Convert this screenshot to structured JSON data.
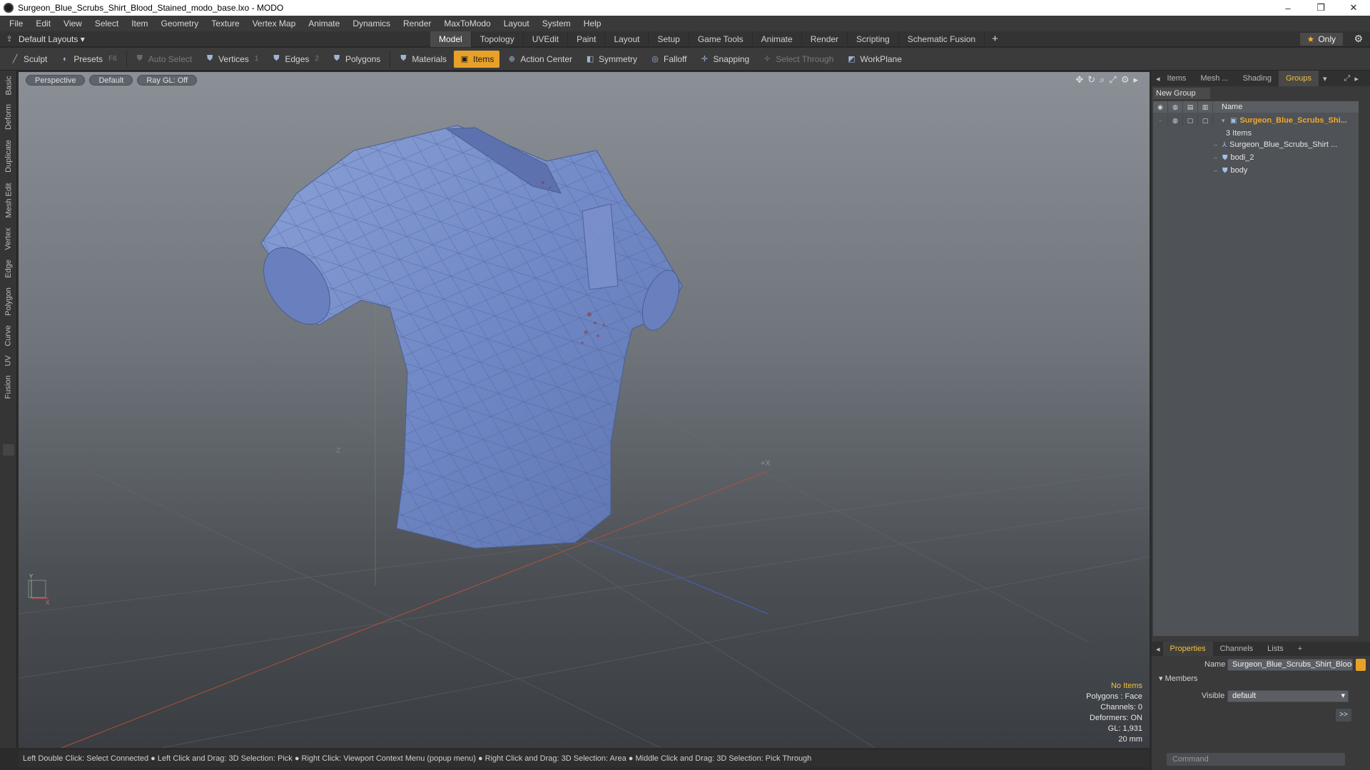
{
  "window": {
    "title": "Surgeon_Blue_Scrubs_Shirt_Blood_Stained_modo_base.lxo - MODO",
    "controls": [
      "–",
      "❐",
      "✕"
    ]
  },
  "menu": [
    "File",
    "Edit",
    "View",
    "Select",
    "Item",
    "Geometry",
    "Texture",
    "Vertex Map",
    "Animate",
    "Dynamics",
    "Render",
    "MaxToModo",
    "Layout",
    "System",
    "Help"
  ],
  "layoutbar": {
    "layout_select": "Default Layouts ▾",
    "tabs": [
      "Model",
      "Topology",
      "UVEdit",
      "Paint",
      "Layout",
      "Setup",
      "Game Tools",
      "Animate",
      "Render",
      "Scripting",
      "Schematic Fusion"
    ],
    "active_tab": "Model",
    "plus": "+",
    "only_label": "Only"
  },
  "toolbar": {
    "sculpt": "Sculpt",
    "presets": "Presets",
    "presets_key": "F6",
    "auto_select": "Auto Select",
    "vertices": "Vertices",
    "vertices_key": "1",
    "edges": "Edges",
    "edges_key": "2",
    "polygons": "Polygons",
    "materials": "Materials",
    "items": "Items",
    "action_center": "Action Center",
    "symmetry": "Symmetry",
    "falloff": "Falloff",
    "snapping": "Snapping",
    "select_through": "Select Through",
    "workplane": "WorkPlane"
  },
  "left_tabs": [
    "Basic",
    "Deform",
    "Duplicate",
    "Mesh Edit",
    "Vertex",
    "Edge",
    "Polygon",
    "Curve",
    "UV",
    "Fusion"
  ],
  "viewport": {
    "view_mode": "Perspective",
    "shading": "Default",
    "raygl": "Ray GL: Off",
    "stats": {
      "selection": "No Items",
      "polygons": "Polygons : Face",
      "channels": "Channels: 0",
      "deformers": "Deformers: ON",
      "gl": "GL: 1,931",
      "scale": "20 mm"
    },
    "axis_x": "X",
    "axis_y": "Y",
    "axis_z": "Z"
  },
  "right_panel": {
    "tabs": [
      "Items",
      "Mesh ...",
      "Shading",
      "Groups"
    ],
    "active_tab": "Groups",
    "new_group": "New Group",
    "column_name": "Name",
    "group_name": "Surgeon_Blue_Scrubs_Shi...",
    "group_count": "3 Items",
    "items": [
      "Surgeon_Blue_Scrubs_Shirt ...",
      "bodi_2",
      "body"
    ]
  },
  "properties": {
    "tabs": [
      "Properties",
      "Channels",
      "Lists",
      "+"
    ],
    "active_tab": "Properties",
    "name_label": "Name",
    "name_value": "Surgeon_Blue_Scrubs_Shirt_Blood",
    "members_label": "Members",
    "visible_label": "Visible",
    "visible_value": "default",
    "arrow_button": ">>"
  },
  "command_placeholder": "Command",
  "status_text": "Left Double Click: Select Connected ● Left Click and Drag: 3D Selection: Pick ● Right Click: Viewport Context Menu (popup menu) ● Right Click and Drag: 3D Selection: Area ● Middle Click and Drag: 3D Selection: Pick Through"
}
